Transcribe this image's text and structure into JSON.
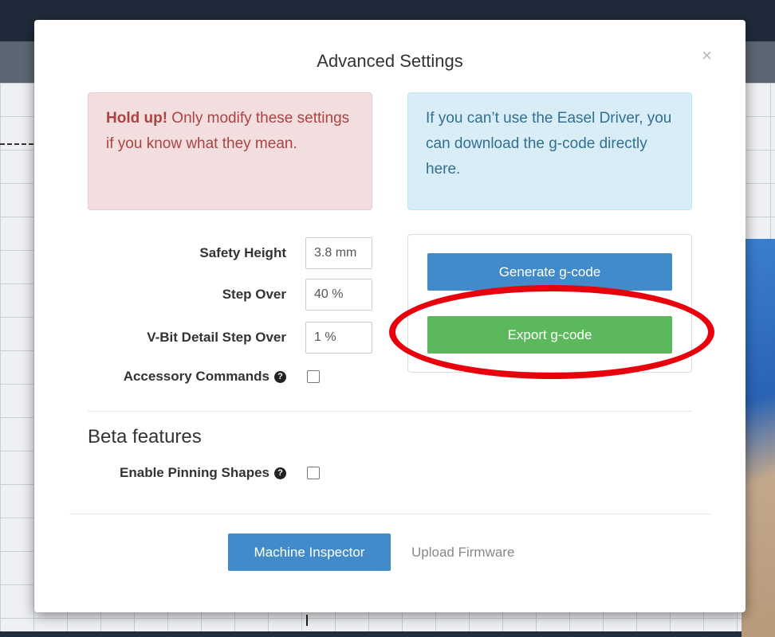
{
  "modal": {
    "title": "Advanced Settings",
    "close_label": "×"
  },
  "alerts": {
    "danger_strong": "Hold up!",
    "danger_text": " Only modify these settings if you know what they mean.",
    "info_text": "If you can’t use the Easel Driver, you can download the g-code directly here."
  },
  "settings": {
    "safety_height": {
      "label": "Safety Height",
      "value": "3.8 mm"
    },
    "step_over": {
      "label": "Step Over",
      "value": "40 %"
    },
    "vbit_step_over": {
      "label": "V-Bit Detail Step Over",
      "value": "1 %"
    },
    "accessory_commands": {
      "label": "Accessory Commands",
      "checked": false
    }
  },
  "gcode": {
    "generate_label": "Generate g-code",
    "export_label": "Export g-code"
  },
  "beta": {
    "title": "Beta features",
    "pinning_label": "Enable Pinning Shapes",
    "pinning_checked": false
  },
  "footer": {
    "machine_inspector_label": "Machine Inspector",
    "upload_firmware_label": "Upload Firmware"
  },
  "icons": {
    "help": "question-circle-icon",
    "close": "close-icon"
  },
  "colors": {
    "primary": "#428bca",
    "success": "#5cb85c",
    "danger_bg": "#f2dede",
    "info_bg": "#d9edf7",
    "annotation": "#e8000c"
  }
}
